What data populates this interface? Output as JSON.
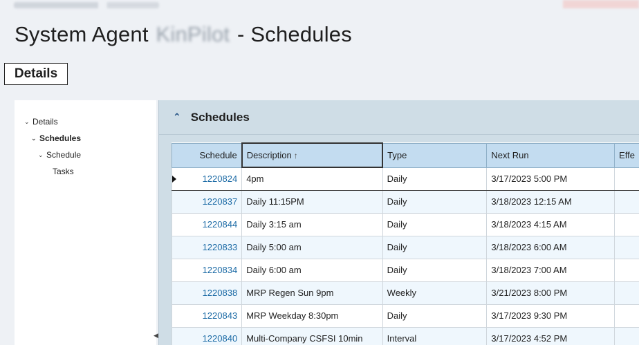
{
  "header": {
    "title_prefix": "System Agent",
    "title_redacted": "KinPilot",
    "title_suffix": "- Schedules"
  },
  "tabs": {
    "details": "Details"
  },
  "tree": {
    "items": [
      {
        "label": "Details",
        "bold": false
      },
      {
        "label": "Schedules",
        "bold": true
      },
      {
        "label": "Schedule",
        "bold": false
      },
      {
        "label": "Tasks",
        "bold": false
      }
    ]
  },
  "panel": {
    "title": "Schedules",
    "columns": {
      "schedule": "Schedule",
      "description": "Description",
      "type": "Type",
      "next_run": "Next Run",
      "effective": "Effe"
    },
    "sort_arrow": "↑",
    "rows": [
      {
        "schedule": "1220824",
        "description": "4pm",
        "type": "Daily",
        "next_run": "3/17/2023 5:00 PM"
      },
      {
        "schedule": "1220837",
        "description": "Daily 11:15PM",
        "type": "Daily",
        "next_run": "3/18/2023 12:15 AM"
      },
      {
        "schedule": "1220844",
        "description": "Daily 3:15 am",
        "type": "Daily",
        "next_run": "3/18/2023 4:15 AM"
      },
      {
        "schedule": "1220833",
        "description": "Daily 5:00 am",
        "type": "Daily",
        "next_run": "3/18/2023 6:00 AM"
      },
      {
        "schedule": "1220834",
        "description": "Daily 6:00 am",
        "type": "Daily",
        "next_run": "3/18/2023 7:00 AM"
      },
      {
        "schedule": "1220838",
        "description": "MRP Regen Sun 9pm",
        "type": "Weekly",
        "next_run": "3/21/2023 8:00 PM"
      },
      {
        "schedule": "1220843",
        "description": "MRP Weekday 8:30pm",
        "type": "Daily",
        "next_run": "3/17/2023 9:30 PM"
      },
      {
        "schedule": "1220840",
        "description": "Multi-Company CSFSI 10min",
        "type": "Interval",
        "next_run": "3/17/2023 4:52 PM"
      }
    ]
  }
}
